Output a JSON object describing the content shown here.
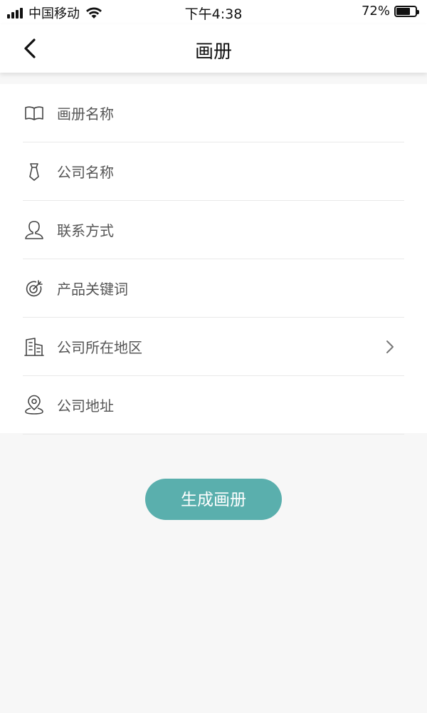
{
  "status_bar": {
    "carrier": "中国移动",
    "time": "下午4:38",
    "battery_percent": "72%",
    "battery_level": 0.72
  },
  "header": {
    "title": "画册",
    "back_icon": "chevron-left-icon"
  },
  "form": {
    "rows": [
      {
        "label": "画册名称",
        "icon": "book-icon"
      },
      {
        "label": "公司名称",
        "icon": "tie-icon"
      },
      {
        "label": "联系方式",
        "icon": "person-icon"
      },
      {
        "label": "产品关键词",
        "icon": "target-icon"
      },
      {
        "label": "公司所在地区",
        "icon": "building-icon",
        "has_chevron": true
      },
      {
        "label": "公司地址",
        "icon": "location-pin-icon"
      }
    ]
  },
  "actions": {
    "generate_label": "生成画册"
  },
  "colors": {
    "accent": "#5aafad",
    "background": "#f7f7f7",
    "divider": "#e9e9e9"
  }
}
